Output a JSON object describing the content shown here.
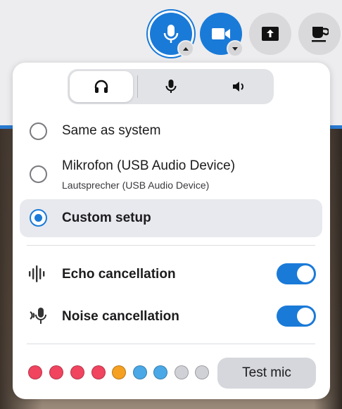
{
  "toolbar": {
    "buttons": [
      {
        "name": "microphone",
        "icon": "microphone-icon",
        "active": true
      },
      {
        "name": "camera",
        "icon": "video-camera-icon",
        "active": true
      },
      {
        "name": "share-screen",
        "icon": "share-screen-icon",
        "active": false
      },
      {
        "name": "break",
        "icon": "coffee-cup-icon",
        "active": false
      }
    ],
    "accent": "#1a7ad8"
  },
  "popup": {
    "tabs": [
      {
        "icon": "headset-icon",
        "selected": true
      },
      {
        "icon": "microphone-icon",
        "selected": false
      },
      {
        "icon": "speaker-icon",
        "selected": false
      }
    ],
    "options": [
      {
        "label": "Same as system",
        "sub": "",
        "selected": false
      },
      {
        "label": "Mikrofon (USB Audio Device)",
        "sub": "Lautsprecher (USB Audio Device)",
        "selected": false
      },
      {
        "label": "Custom setup",
        "sub": "",
        "selected": true
      }
    ],
    "features": [
      {
        "label": "Echo cancellation",
        "icon": "echo-waveform-icon",
        "enabled": true
      },
      {
        "label": "Noise cancellation",
        "icon": "noise-mic-icon",
        "enabled": true
      }
    ],
    "level_meter": {
      "colors": [
        "#f0445f",
        "#f0445f",
        "#f0445f",
        "#f0445f",
        "#f5a020",
        "#4aa8e6",
        "#4aa8e6",
        "#d0d1d6",
        "#d0d1d6"
      ]
    },
    "test_button": "Test mic"
  }
}
